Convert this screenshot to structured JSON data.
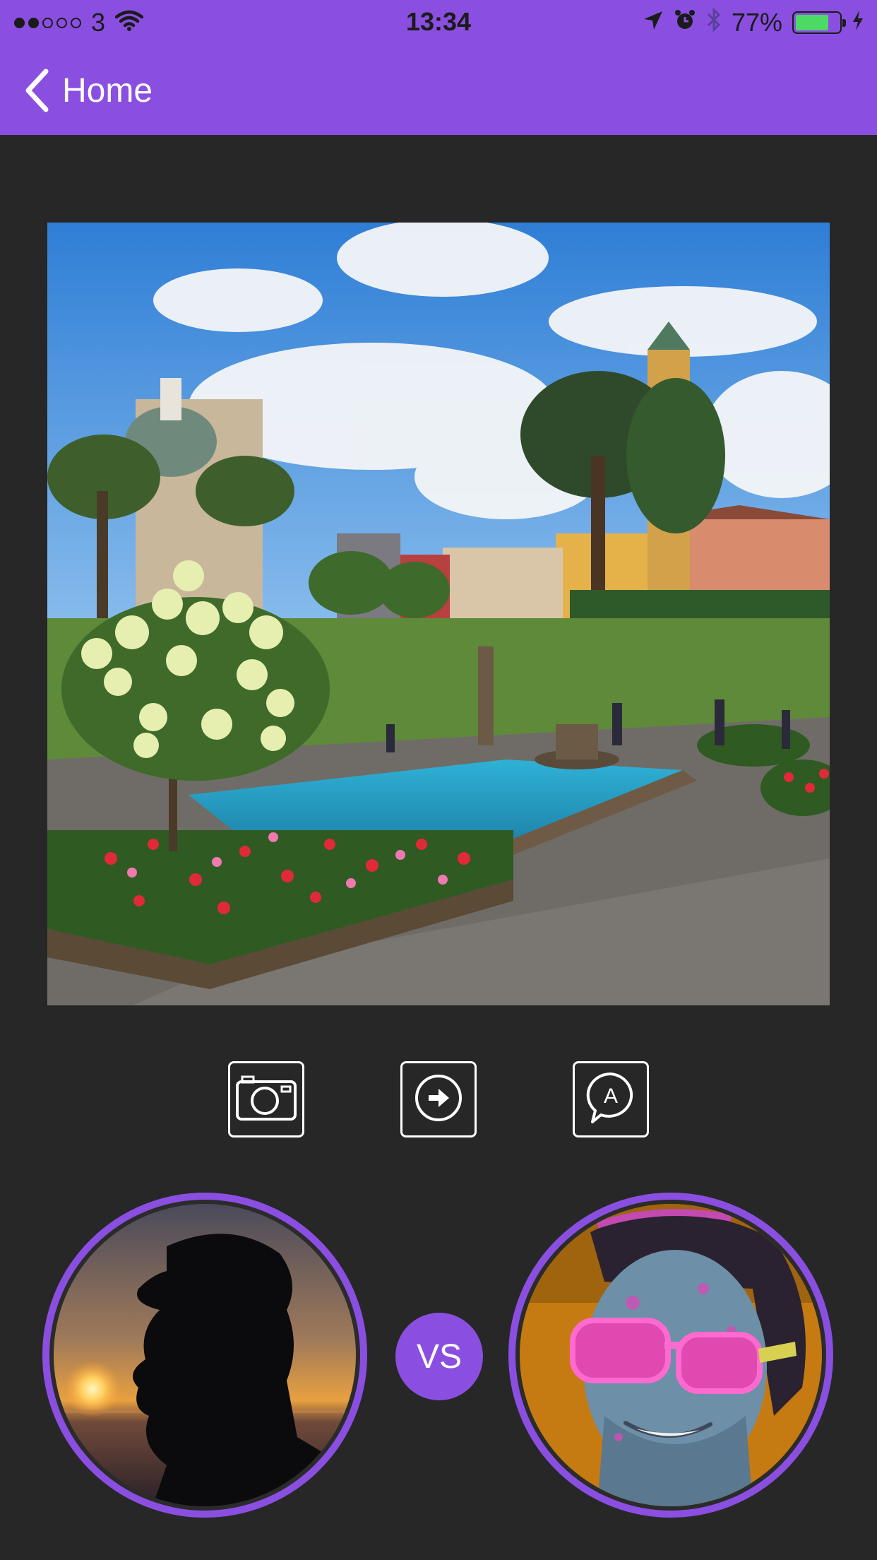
{
  "status_bar": {
    "carrier": "3",
    "time": "13:34",
    "battery_percent": "77%",
    "battery_level": 0.77,
    "signal_bars_filled": 2,
    "signal_bars_total": 5
  },
  "nav": {
    "back_label": "Home",
    "back_icon": "chevron-left-icon"
  },
  "actions": {
    "camera_icon": "camera-icon",
    "next_icon": "arrow-right-circle-icon",
    "comment_icon": "speech-bubble-a-icon",
    "comment_glyph": "A"
  },
  "versus": {
    "label": "VS"
  },
  "colors": {
    "accent": "#8a4fe0",
    "background": "#272727",
    "battery_green": "#4cd964"
  }
}
